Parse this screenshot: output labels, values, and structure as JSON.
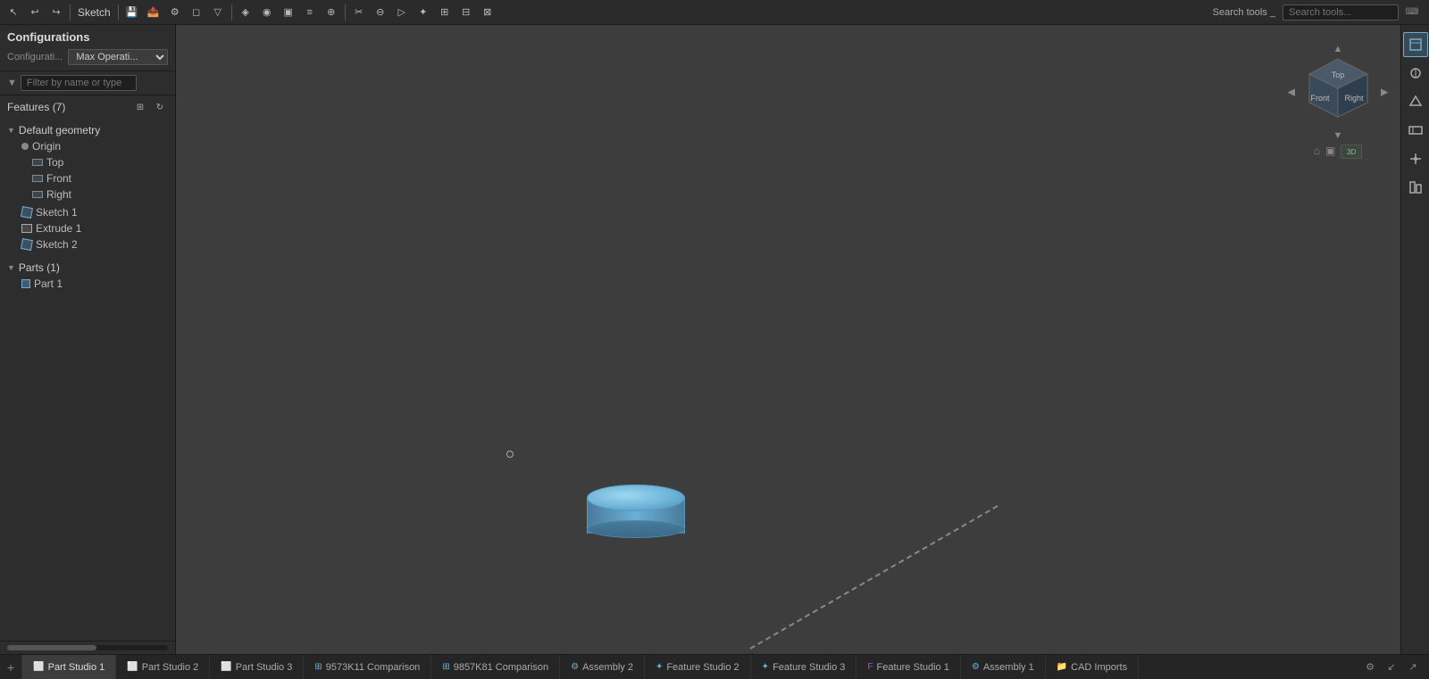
{
  "toolbar": {
    "mode_label": "Sketch",
    "search_tools_label": "Search tools _"
  },
  "sidebar": {
    "configurations_label": "Configurations",
    "config_key": "Configurati...",
    "config_value": "Max Operati...",
    "filter_placeholder": "Filter by name or type",
    "features_label": "Features (7)",
    "feature_tree": {
      "default_geometry_label": "Default geometry",
      "origin_label": "Origin",
      "top_label": "Top",
      "front_label": "Front",
      "right_label": "Right",
      "sketch1_label": "Sketch 1",
      "extrude1_label": "Extrude 1",
      "sketch2_label": "Sketch 2"
    },
    "parts_label": "Parts (1)",
    "part1_label": "Part 1"
  },
  "nav_cube": {
    "front_label": "Front",
    "top_label": "Top",
    "right_label": "Right"
  },
  "bottom_tabs": [
    {
      "id": "part-studio-1",
      "label": "Part Studio 1",
      "active": true,
      "icon": "part-studio-icon"
    },
    {
      "id": "part-studio-2",
      "label": "Part Studio 2",
      "active": false,
      "icon": "part-studio-icon"
    },
    {
      "id": "part-studio-3",
      "label": "Part Studio 3",
      "active": false,
      "icon": "part-studio-icon"
    },
    {
      "id": "comparison-1",
      "label": "9573K11 Comparison",
      "active": false,
      "icon": "comparison-icon"
    },
    {
      "id": "comparison-2",
      "label": "9857K81 Comparison",
      "active": false,
      "icon": "comparison-icon"
    },
    {
      "id": "assembly-2",
      "label": "Assembly 2",
      "active": false,
      "icon": "assembly-icon"
    },
    {
      "id": "feature-studio-2",
      "label": "Feature Studio 2",
      "active": false,
      "icon": "feature-icon"
    },
    {
      "id": "feature-studio-3",
      "label": "Feature Studio 3",
      "active": false,
      "icon": "feature-icon"
    },
    {
      "id": "feature-studio-4",
      "label": "Feature Studio 1",
      "active": false,
      "icon": "feature-icon"
    },
    {
      "id": "assembly-1",
      "label": "Assembly 1",
      "active": false,
      "icon": "assembly-icon"
    },
    {
      "id": "cad-imports",
      "label": "CAD Imports",
      "active": false,
      "icon": "cad-icon"
    }
  ]
}
